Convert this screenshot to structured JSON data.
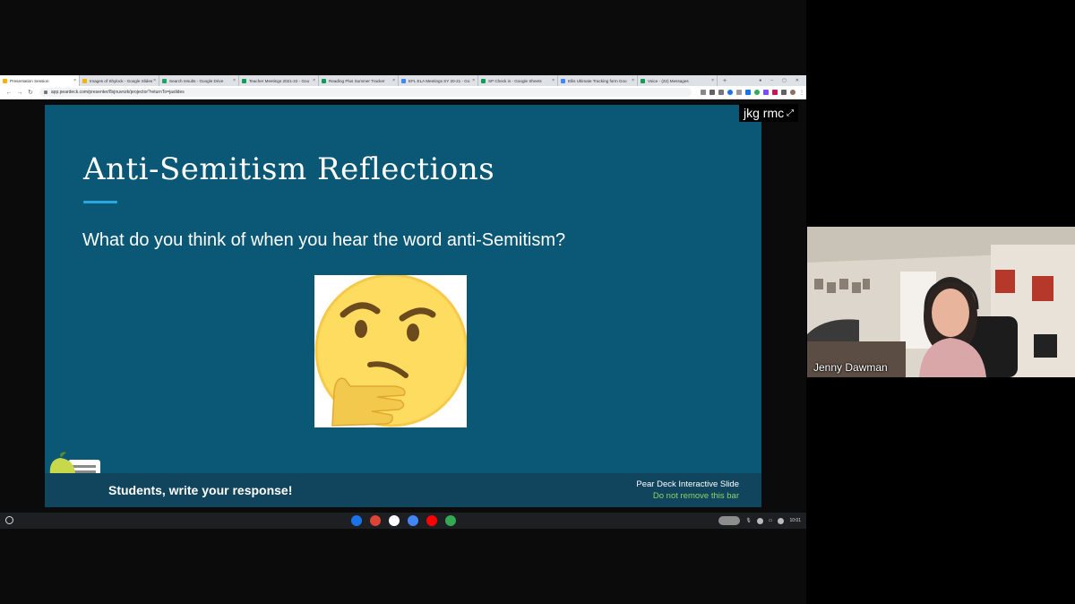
{
  "browser": {
    "tabs": [
      {
        "label": "Presentation Session",
        "color": "#f4b400",
        "active": true
      },
      {
        "label": "Images of Shylock - Google Slides",
        "color": "#f4b400",
        "active": false
      },
      {
        "label": "Search results - Google Drive",
        "color": "#1fa463",
        "active": false
      },
      {
        "label": "Teacher Meetings 2021-22 - Goo",
        "color": "#0f9d58",
        "active": false
      },
      {
        "label": "Reading Plus Summer Tracker",
        "color": "#0f9d58",
        "active": false
      },
      {
        "label": "EFL ELA Meetings SY 20-21 - Go",
        "color": "#4285f4",
        "active": false
      },
      {
        "label": "SP Check in - Google Sheets",
        "color": "#0f9d58",
        "active": false
      },
      {
        "label": "Ellis Ultimate Tracking form Goo",
        "color": "#4285f4",
        "active": false
      },
      {
        "label": "Voice - (22) Messages",
        "color": "#0f9d58",
        "active": false
      }
    ],
    "new_tab": "+",
    "url": "app.peardeck.com/presenter/8sjnuvnzk/projector?returnTo=jaslides"
  },
  "slide": {
    "title": "Anti-Semitism Reflections",
    "question": "What do you think of when you hear the word anti-Semitism?",
    "image_icon": "thinking-face-emoji",
    "bar_prompt": "Students, write your response!",
    "bar_brand": "Pear Deck Interactive Slide",
    "bar_note": "Do not remove this bar",
    "accent": "#29a8e0",
    "background": "#0a5875"
  },
  "presenter_badge": {
    "text": "jkg rmc",
    "icon": "expand-arrows-icon"
  },
  "taskbar": {
    "apps": [
      {
        "name": "files",
        "color": "#1a73e8"
      },
      {
        "name": "chrome",
        "color": "#db4437"
      },
      {
        "name": "gmail",
        "color": "#ffffff"
      },
      {
        "name": "docs",
        "color": "#4285f4"
      },
      {
        "name": "youtube",
        "color": "#ff0000"
      },
      {
        "name": "play-store",
        "color": "#34a853"
      }
    ],
    "time": "10:01"
  },
  "webcam": {
    "name": "Jenny Dawman"
  }
}
